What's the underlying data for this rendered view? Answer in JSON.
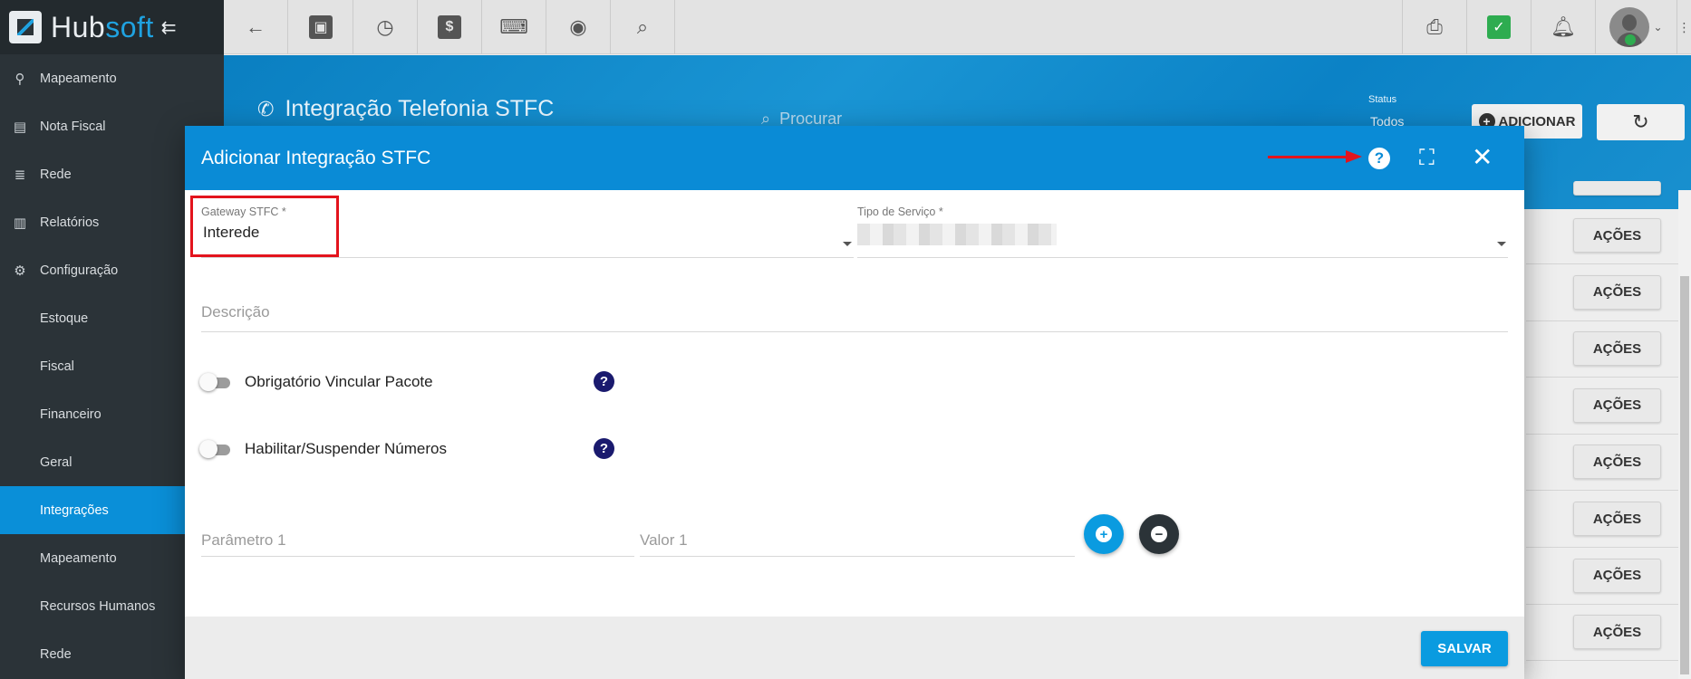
{
  "brand": {
    "hub": "Hub",
    "soft": "soft"
  },
  "sidebar": {
    "items": [
      {
        "label": "Mapeamento",
        "icon": "map-pin-icon",
        "glyph": "⚲"
      },
      {
        "label": "Nota Fiscal",
        "icon": "document-icon",
        "glyph": "▤"
      },
      {
        "label": "Rede",
        "icon": "server-icon",
        "glyph": "≣"
      },
      {
        "label": "Relatórios",
        "icon": "report-icon",
        "glyph": "▥"
      },
      {
        "label": "Configuração",
        "icon": "gear-icon",
        "glyph": "⚙"
      }
    ],
    "subitems": [
      {
        "label": "Estoque"
      },
      {
        "label": "Fiscal"
      },
      {
        "label": "Financeiro"
      },
      {
        "label": "Geral"
      },
      {
        "label": "Integrações",
        "active": true
      },
      {
        "label": "Mapeamento"
      },
      {
        "label": "Recursos Humanos"
      },
      {
        "label": "Rede"
      }
    ]
  },
  "page": {
    "title": "Integração Telefonia STFC",
    "search_placeholder": "Procurar",
    "status_label": "Status",
    "status_value": "Todos",
    "add_label": "ADICIONAR"
  },
  "list": {
    "action_label": "AÇÕES"
  },
  "modal": {
    "title": "Adicionar Integração STFC",
    "gateway": {
      "label": "Gateway STFC *",
      "value": "Interede"
    },
    "tipo_servico": {
      "label": "Tipo de Serviço *"
    },
    "descricao": {
      "placeholder": "Descrição"
    },
    "toggles": [
      {
        "label": "Obrigatório Vincular Pacote",
        "checked": false
      },
      {
        "label": "Habilitar/Suspender Números",
        "checked": false
      }
    ],
    "parametro": {
      "placeholder": "Parâmetro 1"
    },
    "valor": {
      "placeholder": "Valor 1"
    },
    "save_label": "SALVAR"
  },
  "colors": {
    "primary": "#0a8bd6",
    "sidebar_bg": "#2b3338",
    "active_item": "#0a8fd8",
    "annotation_red": "#e3141d",
    "remove_button": "#2b3338",
    "help_dark": "#1a1a6e"
  }
}
